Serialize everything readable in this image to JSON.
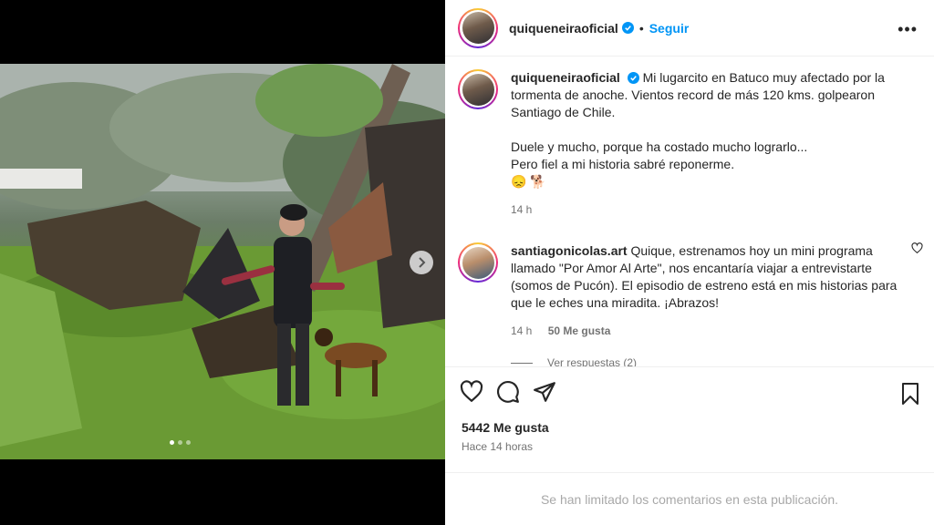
{
  "post": {
    "username": "quiqueneiraoficial",
    "separator": "•",
    "follow_label": "Seguir",
    "more_label": "•••",
    "caption_lines": [
      "Mi lugarcito en Batuco muy afectado por la tormenta de anoche. Vientos record de más 120 kms. golpearon Santiago de Chile.",
      "Duele y mucho, porque ha costado mucho lograrlo...",
      "Pero fiel a mi historia sabré reponerme."
    ],
    "caption_emojis": "😞 🐕",
    "caption_time": "14 h",
    "likes": "5442 Me gusta",
    "posted_ago": "Hace 14 horas",
    "comments_limited": "Se han limitado los comentarios en esta publicación.",
    "carousel": {
      "total_slides": 3,
      "active_slide": 1
    }
  },
  "comment": {
    "username": "santiagonicolas.art",
    "text": "Quique, estrenamos hoy un mini programa llamado \"Por Amor Al Arte\", nos encantaría viajar a entrevistarte (somos de Pucón). El episodio de estreno está en mis historias para que le eches una miradita. ¡Abrazos!",
    "time": "14 h",
    "likes": "50 Me gusta",
    "replies": "Ver respuestas (2)"
  },
  "icons": {
    "like": "heart-icon",
    "comment": "comment-icon",
    "share": "share-icon",
    "save": "bookmark-icon",
    "next": "chevron-right-icon",
    "verified": "verified-badge-icon"
  },
  "colors": {
    "accent": "#0095f6",
    "text": "#262626",
    "muted": "#737373",
    "disabled": "#a8a8a8"
  }
}
